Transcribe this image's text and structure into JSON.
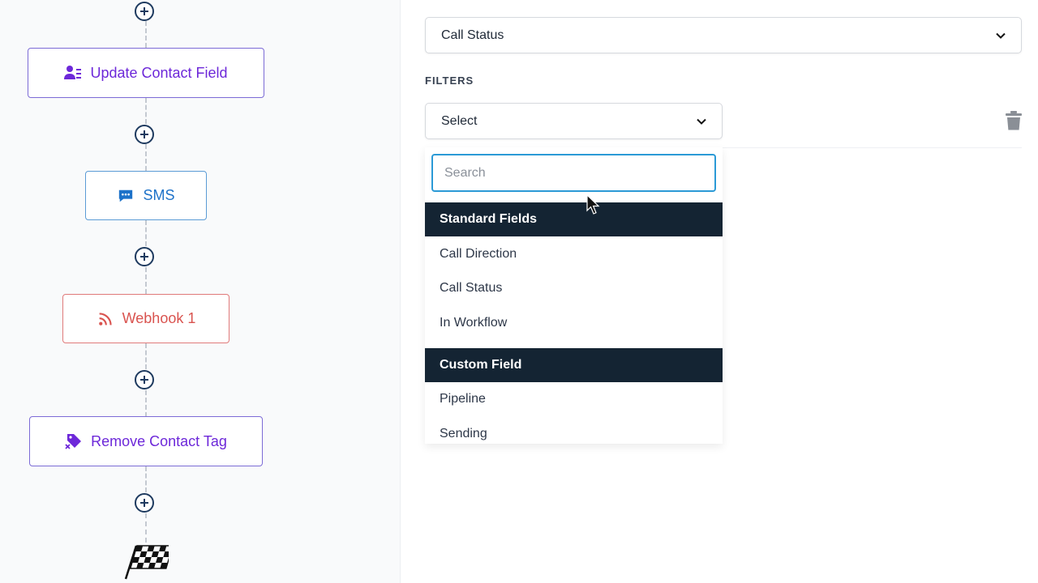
{
  "workflow": {
    "nodes": [
      {
        "label": "Update Contact Field",
        "icon": "person-list-icon",
        "color": "#6d28d9"
      },
      {
        "label": "SMS",
        "icon": "chat-bubble-icon",
        "color": "#1d72c9"
      },
      {
        "label": "Webhook 1",
        "icon": "rss-icon",
        "color": "#d9534f"
      },
      {
        "label": "Remove Contact Tag",
        "icon": "tag-remove-icon",
        "color": "#6d28d9"
      }
    ],
    "end_icon": "checkered-flag-icon"
  },
  "panel": {
    "field_select": {
      "value": "Call Status"
    },
    "filters_label": "FILTERS",
    "filter_select": {
      "value": "Select"
    },
    "dropdown": {
      "search_placeholder": "Search",
      "groups": [
        {
          "label": "Standard Fields",
          "options": [
            "Call Direction",
            "Call Status",
            "In Workflow"
          ]
        },
        {
          "label": "Custom Field",
          "options": [
            "Pipeline",
            "Sending"
          ]
        }
      ]
    }
  },
  "colors": {
    "group_header_bg": "#142433",
    "search_focus_border": "#2b9ad6",
    "add_button": "#1e3a5f"
  }
}
